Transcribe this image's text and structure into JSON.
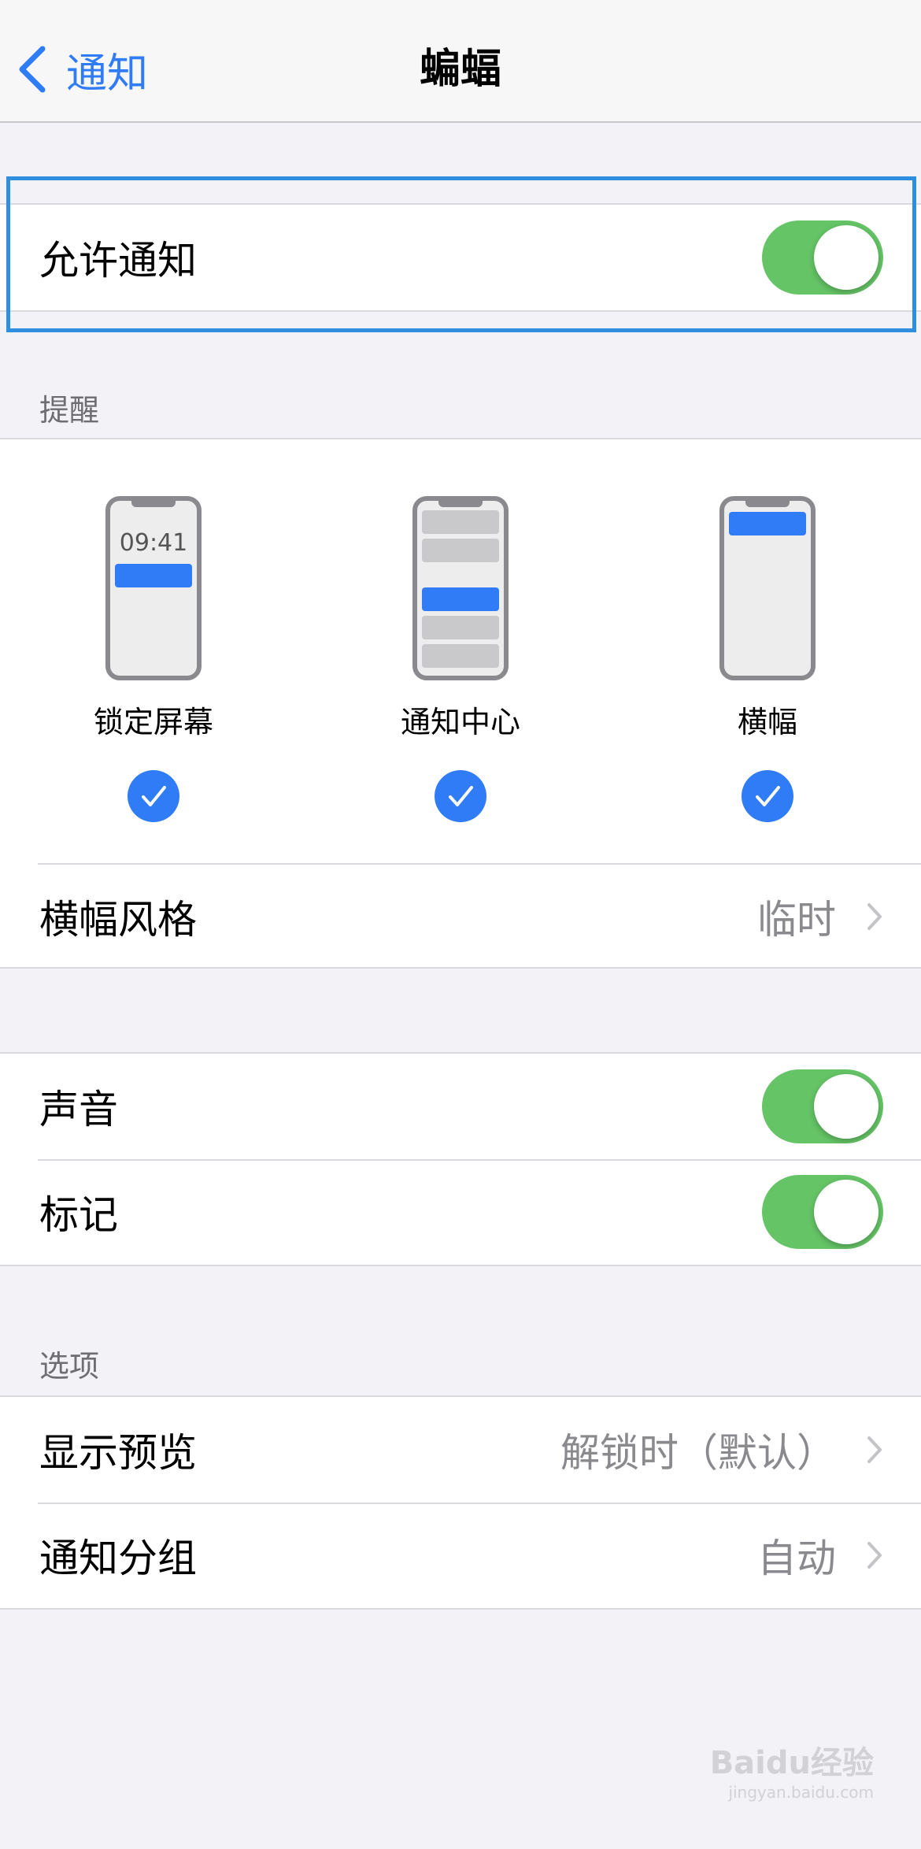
{
  "nav": {
    "back_label": "通知",
    "title": "蝙蝠"
  },
  "allow": {
    "label": "允许通知",
    "enabled": true
  },
  "alerts": {
    "header": "提醒",
    "options": [
      {
        "label": "锁定屏幕",
        "time": "09:41",
        "checked": true
      },
      {
        "label": "通知中心",
        "checked": true
      },
      {
        "label": "横幅",
        "checked": true
      }
    ],
    "banner_style_label": "横幅风格",
    "banner_style_value": "临时"
  },
  "sounds": {
    "label": "声音",
    "enabled": true
  },
  "badges": {
    "label": "标记",
    "enabled": true
  },
  "options": {
    "header": "选项",
    "preview_label": "显示预览",
    "preview_value": "解锁时（默认）",
    "grouping_label": "通知分组",
    "grouping_value": "自动"
  },
  "watermark": {
    "brand": "Baidu经验",
    "url": "jingyan.baidu.com"
  },
  "colors": {
    "accent": "#2f7cf6",
    "toggle_on": "#65c466",
    "highlight": "#2d8fdd"
  }
}
